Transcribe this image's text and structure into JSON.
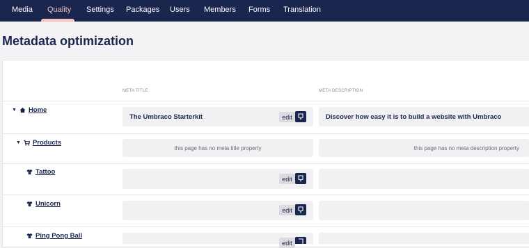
{
  "nav": {
    "items": [
      {
        "label": "Media"
      },
      {
        "label": "Quality",
        "active": true
      },
      {
        "label": "Settings"
      },
      {
        "label": "Packages"
      },
      {
        "label": "Users"
      },
      {
        "label": "Members"
      },
      {
        "label": "Forms"
      },
      {
        "label": "Translation"
      }
    ]
  },
  "page": {
    "title": "Metadata optimization"
  },
  "table": {
    "col_meta_title": "META TITLE",
    "col_meta_description": "META DESCRIPTION",
    "edit_label": "edit",
    "rows": [
      {
        "name": "Home",
        "icon": "home-icon",
        "expandable": true,
        "meta_title": "The Umbraco Starterkit",
        "meta_description": "Discover how easy it is to build a website with Umbraco"
      },
      {
        "name": "Products",
        "icon": "cart-icon",
        "expandable": true,
        "meta_title_empty": "this page has no meta title property",
        "meta_description_empty": "this page has no meta description property"
      },
      {
        "name": "Tattoo",
        "icon": "shirt-icon",
        "expandable": false,
        "meta_title": "",
        "meta_description": ""
      },
      {
        "name": "Unicorn",
        "icon": "shirt-icon",
        "expandable": false,
        "meta_title": "",
        "meta_description": ""
      },
      {
        "name": "Ping Pong Ball",
        "icon": "shirt-icon",
        "expandable": false,
        "meta_title": "",
        "meta_description": ""
      }
    ]
  },
  "colors": {
    "nav_bg": "#1b264f",
    "accent": "#f5c1bc",
    "text": "#1b264f"
  }
}
